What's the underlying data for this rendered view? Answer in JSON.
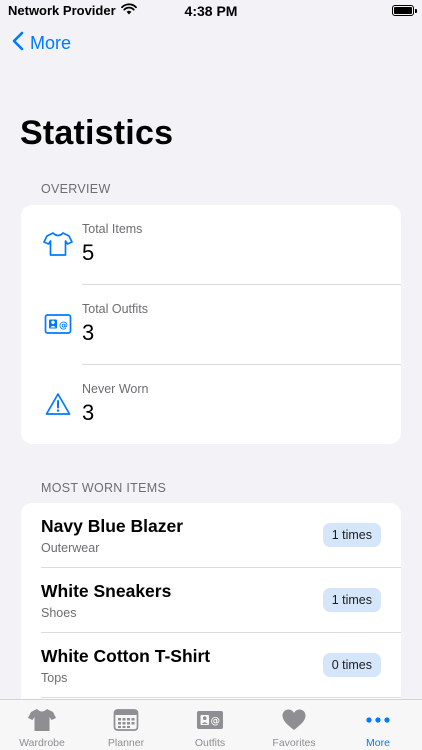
{
  "status_bar": {
    "carrier": "Network Provider",
    "time": "4:38 PM"
  },
  "nav": {
    "back_label": "More"
  },
  "page": {
    "title": "Statistics"
  },
  "overview": {
    "header": "OVERVIEW",
    "items": [
      {
        "label": "Total Items",
        "value": "5",
        "icon": "tshirt-icon"
      },
      {
        "label": "Total Outfits",
        "value": "3",
        "icon": "contact-card-icon"
      },
      {
        "label": "Never Worn",
        "value": "3",
        "icon": "warning-triangle-icon"
      }
    ]
  },
  "most_worn": {
    "header": "MOST WORN ITEMS",
    "items": [
      {
        "name": "Navy Blue Blazer",
        "category": "Outerwear",
        "count": "1 times"
      },
      {
        "name": "White Sneakers",
        "category": "Shoes",
        "count": "1 times"
      },
      {
        "name": "White Cotton T-Shirt",
        "category": "Tops",
        "count": "0 times"
      }
    ]
  },
  "tab_bar": {
    "tabs": [
      {
        "label": "Wardrobe",
        "icon": "tshirt-fill-icon"
      },
      {
        "label": "Planner",
        "icon": "calendar-icon"
      },
      {
        "label": "Outfits",
        "icon": "contact-card-icon"
      },
      {
        "label": "Favorites",
        "icon": "heart-icon"
      },
      {
        "label": "More",
        "icon": "more-dots-icon"
      }
    ],
    "active": "More"
  },
  "colors": {
    "accent": "#007aff",
    "badge_bg": "#d6e6fa",
    "background": "#f2f2f7",
    "secondary_text": "#6d6d72",
    "tab_inactive": "#8e8e93"
  }
}
